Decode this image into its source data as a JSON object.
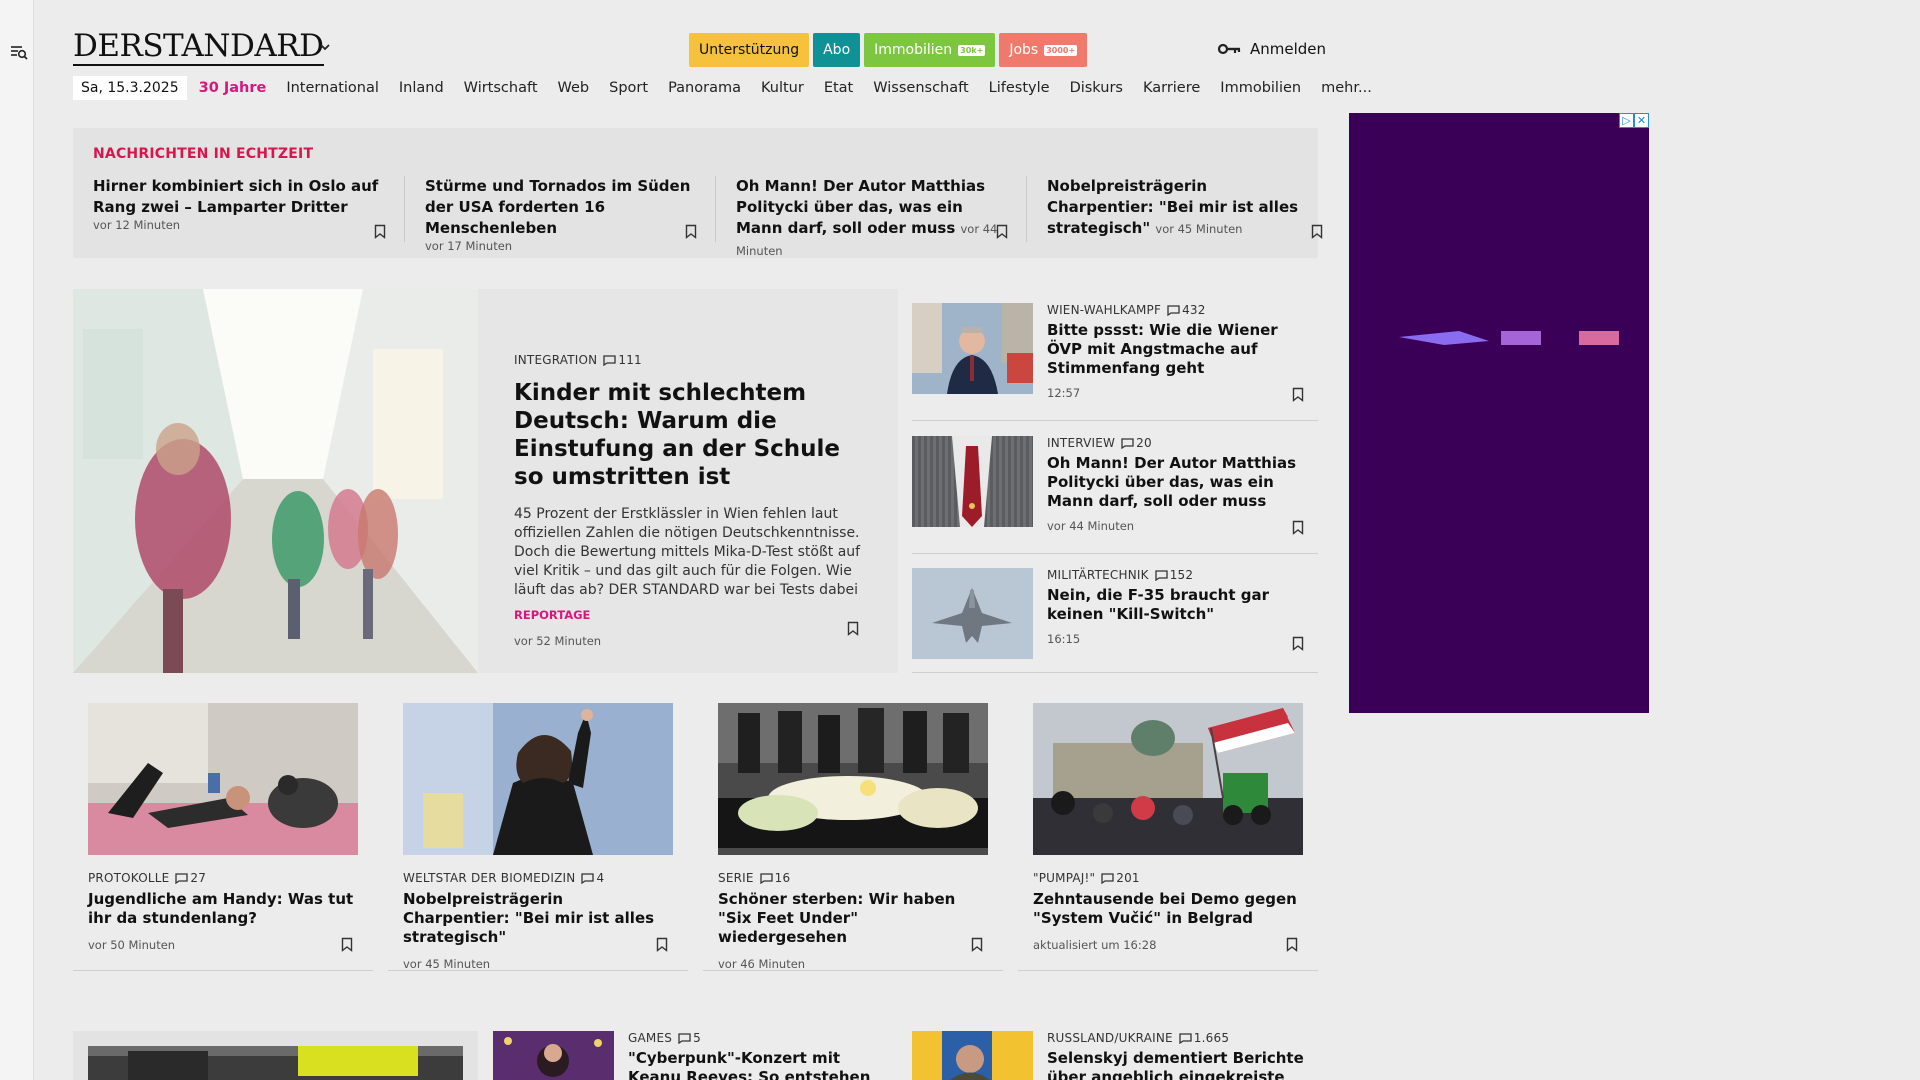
{
  "header": {
    "logo_text": "DERSTANDARD",
    "pills": [
      {
        "label": "Unterstützung",
        "bg": "#f6c23e",
        "fg": "#111"
      },
      {
        "label": "Abo",
        "bg": "#0f9196",
        "fg": "#fff"
      },
      {
        "label": "Immobilien",
        "badge": "30k+",
        "bg": "#7dc63f",
        "fg": "#fff"
      },
      {
        "label": "Jobs",
        "badge": "3000+",
        "bg": "#ef7a6b",
        "fg": "#fff"
      }
    ],
    "login_label": "Anmelden"
  },
  "nav": {
    "date": "Sa, 15.3.2025",
    "items": [
      "30 Jahre",
      "International",
      "Inland",
      "Wirtschaft",
      "Web",
      "Sport",
      "Panorama",
      "Kultur",
      "Etat",
      "Wissenschaft",
      "Lifestyle",
      "Diskurs",
      "Karriere",
      "Immobilien",
      "mehr..."
    ]
  },
  "live": {
    "heading": "NACHRICHTEN IN ECHTZEIT",
    "items": [
      {
        "title": "Hirner kombiniert sich in Oslo auf Rang zwei – Lamparter Dritter",
        "time": "vor 12 Minuten"
      },
      {
        "title": "Stürme und Tornados im Süden der USA forderten 16 Menschenleben",
        "time": "vor 17 Minuten"
      },
      {
        "title": "Oh Mann! Der Autor Matthias Politycki über das, was ein Mann darf, soll oder muss",
        "time": "vor 44 Minuten"
      },
      {
        "title": "Nobelpreisträgerin Charpentier: \"Bei mir ist alles strategisch\"",
        "time": "vor 45 Minuten"
      }
    ]
  },
  "hero": {
    "kicker": "INTEGRATION",
    "comments": "111",
    "title": "Kinder mit schlechtem Deutsch: Warum die Einstufung an der Schule so umstritten ist",
    "lead": "45 Prozent der Erstklässler in Wien fehlen laut offiziellen Zahlen die nötigen Deutschkenntnisse. Doch die Bewertung mittels Mika-D-Test stößt auf viel Kritik – und das gilt auch für die Folgen. Wie läuft das ab? DER STANDARD war bei Tests dabei",
    "tag": "REPORTAGE",
    "time": "vor 52 Minuten"
  },
  "side": [
    {
      "kicker": "WIEN-WAHLKAMPF",
      "comments": "432",
      "title": "Bitte pssst: Wie die Wiener ÖVP mit Angstmache auf Stimmenfang geht",
      "time": "12:57"
    },
    {
      "kicker": "INTERVIEW",
      "comments": "20",
      "title": "Oh Mann! Der Autor Matthias Politycki über das, was ein Mann darf, soll oder muss",
      "time": "vor 44 Minuten"
    },
    {
      "kicker": "MILITÄRTECHNIK",
      "comments": "152",
      "title": "Nein, die F-35 braucht gar keinen \"Kill-Switch\"",
      "time": "16:15"
    }
  ],
  "cards": [
    {
      "kicker": "PROTOKOLLE",
      "comments": "27",
      "title": "Jugendliche am Handy: Was tut ihr da stundenlang?",
      "time": "vor 50 Minuten"
    },
    {
      "kicker": "WELTSTAR DER BIOMEDIZIN",
      "comments": "4",
      "title": "Nobelpreisträgerin Charpentier: \"Bei mir ist alles strategisch\"",
      "time": "vor 45 Minuten"
    },
    {
      "kicker": "SERIE",
      "comments": "16",
      "title": "Schöner sterben: Wir haben \"Six Feet Under\" wiedergesehen",
      "time": "vor 46 Minuten"
    },
    {
      "kicker": "\"PUMPAJ!\"",
      "comments": "201",
      "title": "Zehntausende bei Demo gegen \"System Vučić\" in Belgrad",
      "time": "aktualisiert um 16:28"
    }
  ],
  "row3": [
    {
      "kicker": "GAMES",
      "comments": "5",
      "title": "\"Cyberpunk\"-Konzert mit Keanu Reeves: So entstehen Quests in"
    },
    {
      "kicker": "RUSSLAND/UKRAINE",
      "comments": "1.665",
      "title": "Selenskyj dementiert Berichte über angeblich eingekreiste"
    }
  ],
  "colors": {
    "accent": "#d6177e",
    "live_heading": "#d6174e",
    "ad_bg": "#3a0057"
  }
}
